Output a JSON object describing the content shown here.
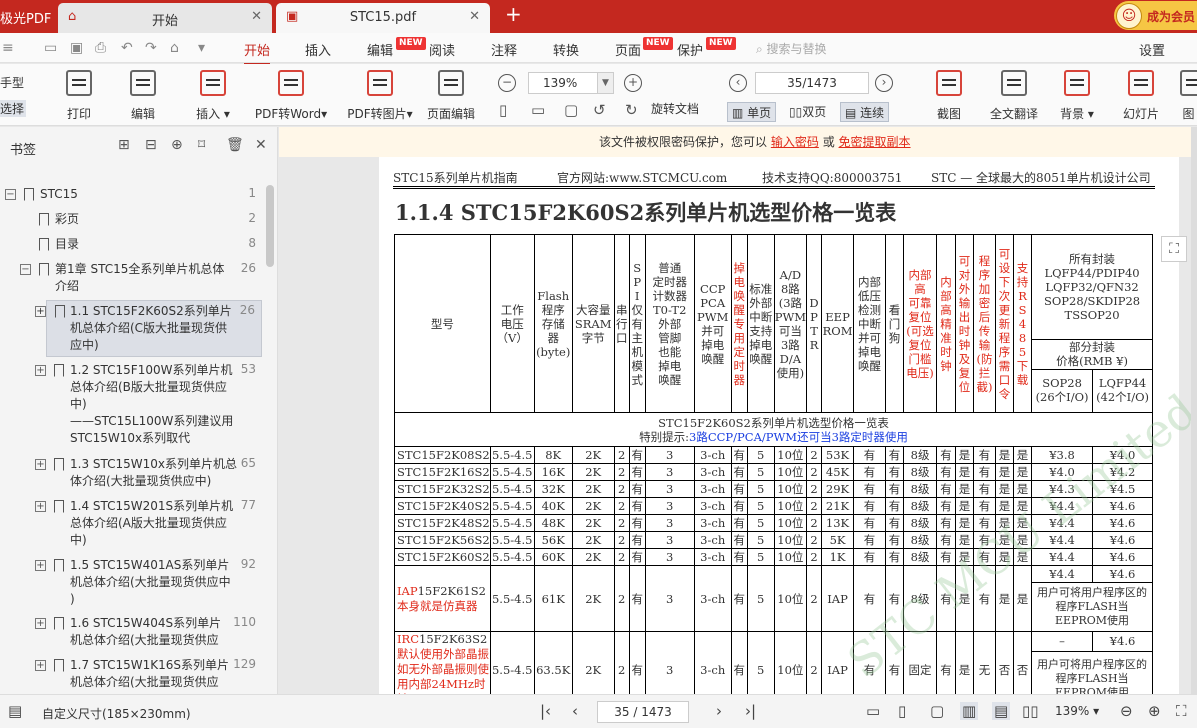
{
  "titlebar": {
    "app_name": "极光PDF",
    "tabs": [
      {
        "label": "开始",
        "icon": "home-icon"
      },
      {
        "label": "STC15.pdf",
        "icon": "pdf-icon"
      }
    ],
    "member_label": "成为会员"
  },
  "menubar": {
    "items": [
      "开始",
      "插入",
      "编辑",
      "阅读",
      "注释",
      "转换",
      "页面",
      "保护"
    ],
    "badge": "NEW",
    "search_placeholder": "搜索与替换",
    "settings": "设置"
  },
  "ribbon": {
    "left_stub": [
      "手型",
      "选择"
    ],
    "buttons": [
      "打印",
      "编辑",
      "插入",
      "PDF转Word",
      "PDF转图片",
      "页面编辑",
      "旋转文档",
      "截图",
      "全文翻译",
      "背景",
      "幻灯片",
      "图"
    ],
    "zoom": "139%",
    "page_input": "35/1473",
    "modes": [
      "单页",
      "双页",
      "连续"
    ]
  },
  "sidebar": {
    "title": "书签",
    "bookmarks": [
      {
        "lines": [
          "STC15"
        ],
        "page": "1"
      },
      {
        "lines": [
          "彩页"
        ],
        "page": "2"
      },
      {
        "lines": [
          "目录"
        ],
        "page": "8"
      },
      {
        "lines": [
          "第1章  STC15全系列单片机总体",
          "介绍"
        ],
        "page": "26"
      },
      {
        "lines": [
          "1.1 STC15F2K60S2系列单片",
          "机总体介绍(C版大批量现货供",
          "应中)"
        ],
        "page": "26"
      },
      {
        "lines": [
          "1.2 STC15F100W系列单片机",
          "总体介绍(B版大批量现货供应",
          "中)",
          "——STC15L100W系列建议用",
          "STC15W10x系列取代"
        ],
        "page": "53"
      },
      {
        "lines": [
          "1.3 STC15W10x系列单片机总",
          "体介绍(大批量现货供应中)"
        ],
        "page": "65"
      },
      {
        "lines": [
          "1.4 STC15W201S系列单片机",
          "总体介绍(A版大批量现货供应",
          "中)"
        ],
        "page": "77"
      },
      {
        "lines": [
          "1.5 STC15W401AS系列单片",
          "机总体介绍(大批量现货供应中",
          ")"
        ],
        "page": "92"
      },
      {
        "lines": [
          "1.6 STC15W404S系列单片",
          "机总体介绍(大批量现货供应"
        ],
        "page": "110"
      },
      {
        "lines": [
          "1.7 STC15W1K16S系列单片",
          "机总体介绍(大批量现货供应"
        ],
        "page": "129"
      }
    ]
  },
  "banner": {
    "text_before": "该文件被权限密码保护，您可以",
    "link_enter": "输入密码",
    "text_or": "或",
    "link_free": "免密提取副本"
  },
  "document": {
    "header": {
      "guide": "STC15系列单片机指南",
      "website": "官方网站:www.STCMCU.com",
      "support": "技术支持QQ:800003751",
      "slogan": "STC — 全球最大的8051单片机设计公司"
    },
    "title": "1.1.4  STC15F2K60S2系列单片机选型价格一览表",
    "watermark": "STC MCU Limited",
    "table": {
      "headers": {
        "model": "型号",
        "voltage": [
          "工作",
          "电压",
          "（V）"
        ],
        "flash": [
          "Flash",
          "程序",
          "存储",
          "器",
          "(byte)"
        ],
        "sram": [
          "大容量",
          "SRAM",
          "字节"
        ],
        "uart": [
          "串",
          "行",
          "口"
        ],
        "spi": [
          "S",
          "P",
          "I",
          "仅",
          "有",
          "主",
          "机",
          "模",
          "式"
        ],
        "timers": [
          "普通",
          "定时器",
          "计数器",
          "T0-T2",
          "外部",
          "管脚",
          "也能",
          "掉电",
          "唤醒"
        ],
        "ccp": [
          "CCP",
          "PCA",
          "PWM",
          "并可",
          "掉电",
          "唤醒"
        ],
        "wake_timer": [
          "掉",
          "电",
          "唤",
          "醒",
          "专",
          "用",
          "定",
          "时",
          "器"
        ],
        "ext_int": [
          "标准",
          "外部",
          "中断",
          "支持",
          "掉电",
          "唤醒"
        ],
        "adc": [
          "A/D",
          "8路",
          "(3路",
          "PWM",
          "可当",
          "3路",
          "D/A",
          "使用)"
        ],
        "dptr": [
          "D",
          "P",
          "T",
          "R"
        ],
        "eeprom": [
          "EEP",
          "ROM"
        ],
        "lvd": [
          "内部",
          "低压",
          "检测",
          "中断",
          "并可",
          "掉电",
          "唤醒"
        ],
        "watchdog": [
          "看",
          "门",
          "狗"
        ],
        "reset": [
          "内部",
          "高",
          "可靠",
          "复位",
          "(可选",
          "复位",
          "门槛",
          "电压)"
        ],
        "osc": [
          "内",
          "部",
          "高",
          "精",
          "准",
          "时",
          "钟"
        ],
        "clock_out": [
          "可",
          "对",
          "外",
          "输",
          "出",
          "时",
          "钟",
          "及",
          "复",
          "位"
        ],
        "encrypt": [
          "程",
          "序",
          "加",
          "密",
          "后",
          "传",
          "输",
          "(防",
          "拦",
          "截)"
        ],
        "isp_pw": [
          "可",
          "设",
          "下",
          "次",
          "更",
          "新",
          "程",
          "序",
          "需",
          "口",
          "令"
        ],
        "rs485": [
          "支",
          "持",
          "R",
          "S",
          "4",
          "8",
          "5",
          "下",
          "载"
        ],
        "packages": [
          "所有封装",
          "LQFP44/PDIP40",
          "LQFP32/QFN32",
          "SOP28/SKDIP28",
          "TSSOP20"
        ],
        "price_head": [
          "部分封装",
          "价格(RMB ¥)"
        ],
        "sop28": [
          "SOP28",
          "(26个I/O)"
        ],
        "lqfp44": [
          "LQFP44",
          "(42个I/O)"
        ]
      },
      "caption_line1": "STC15F2K60S2系列单片机选型价格一览表",
      "caption_line2_prefix": "特别提示:",
      "caption_line2_note": "3路CCP/PCA/PWM还可当3路定时器使用",
      "rows": [
        [
          "STC15F2K08S2",
          "5.5-4.5",
          "8K",
          "2K",
          "2",
          "有",
          "3",
          "3-ch",
          "有",
          "5",
          "10位",
          "2",
          "53K",
          "有",
          "有",
          "8级",
          "有",
          "是",
          "有",
          "是",
          "是",
          "¥3.8",
          "¥4.0"
        ],
        [
          "STC15F2K16S2",
          "5.5-4.5",
          "16K",
          "2K",
          "2",
          "有",
          "3",
          "3-ch",
          "有",
          "5",
          "10位",
          "2",
          "45K",
          "有",
          "有",
          "8级",
          "有",
          "是",
          "有",
          "是",
          "是",
          "¥4.0",
          "¥4.2"
        ],
        [
          "STC15F2K32S2",
          "5.5-4.5",
          "32K",
          "2K",
          "2",
          "有",
          "3",
          "3-ch",
          "有",
          "5",
          "10位",
          "2",
          "29K",
          "有",
          "有",
          "8级",
          "有",
          "是",
          "有",
          "是",
          "是",
          "¥4.3",
          "¥4.5"
        ],
        [
          "STC15F2K40S2",
          "5.5-4.5",
          "40K",
          "2K",
          "2",
          "有",
          "3",
          "3-ch",
          "有",
          "5",
          "10位",
          "2",
          "21K",
          "有",
          "有",
          "8级",
          "有",
          "是",
          "有",
          "是",
          "是",
          "¥4.4",
          "¥4.6"
        ],
        [
          "STC15F2K48S2",
          "5.5-4.5",
          "48K",
          "2K",
          "2",
          "有",
          "3",
          "3-ch",
          "有",
          "5",
          "10位",
          "2",
          "13K",
          "有",
          "有",
          "8级",
          "有",
          "是",
          "有",
          "是",
          "是",
          "¥4.4",
          "¥4.6"
        ],
        [
          "STC15F2K56S2",
          "5.5-4.5",
          "56K",
          "2K",
          "2",
          "有",
          "3",
          "3-ch",
          "有",
          "5",
          "10位",
          "2",
          "5K",
          "有",
          "有",
          "8级",
          "有",
          "是",
          "有",
          "是",
          "是",
          "¥4.4",
          "¥4.6"
        ],
        [
          "STC15F2K60S2",
          "5.5-4.5",
          "60K",
          "2K",
          "2",
          "有",
          "3",
          "3-ch",
          "有",
          "5",
          "10位",
          "2",
          "1K",
          "有",
          "有",
          "8级",
          "有",
          "是",
          "有",
          "是",
          "是",
          "¥4.4",
          "¥4.6"
        ]
      ],
      "iap_row": {
        "model_prefix": "IAP",
        "model_rest": "15F2K61S2",
        "model_note": "本身就是仿真器",
        "cells": [
          "5.5-4.5",
          "61K",
          "2K",
          "2",
          "有",
          "3",
          "3-ch",
          "有",
          "5",
          "10位",
          "2",
          "IAP",
          "有",
          "有",
          "8级",
          "有",
          "是",
          "有",
          "是",
          "是"
        ],
        "price": "¥4.4",
        "price2": "¥4.6",
        "note": "用户可将用户程序区的程序FLASH当EEPROM使用"
      },
      "irc_row": {
        "model_prefix": "IRC",
        "model_rest": "15F2K63S2",
        "model_note": "默认使用外部晶振如无外部晶振则使用内部24MHz时钟",
        "cells": [
          "5.5-4.5",
          "63.5K",
          "2K",
          "2",
          "有",
          "3",
          "3-ch",
          "有",
          "5",
          "10位",
          "2",
          "IAP",
          "有",
          "有",
          "固定",
          "有",
          "是",
          "无",
          "否",
          "否"
        ],
        "price": "–",
        "price2": "¥4.6",
        "note": "用户可将用户程序区的程序FLASH当EEPROM使用"
      }
    }
  },
  "statusbar": {
    "page_size": "自定义尺寸(185×230mm)",
    "page_input": "35 / 1473",
    "zoom": "139%"
  }
}
